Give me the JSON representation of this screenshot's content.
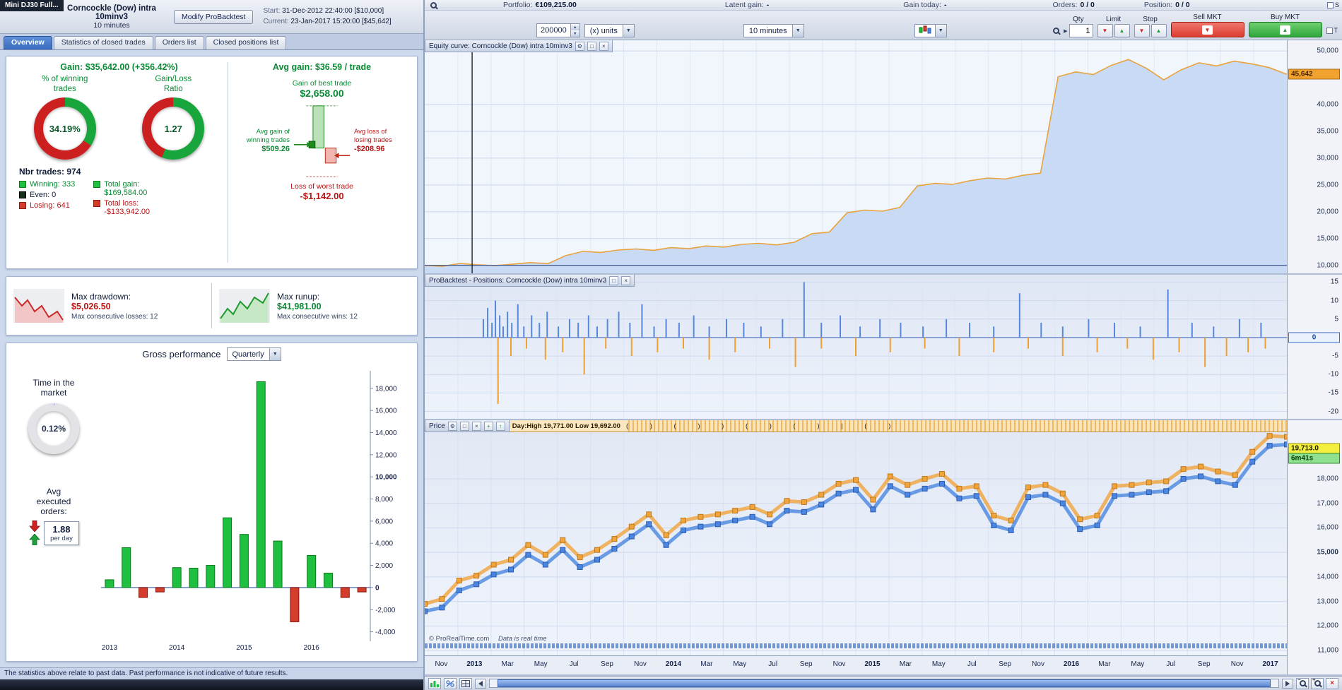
{
  "colors": {
    "green": "#1fbf3f",
    "red": "#d43c2c",
    "accent_blue": "#3a6bc8",
    "equity_line": "#e8a33d",
    "equity_fill": "#c9daf5",
    "sell_red": "#dc3d30",
    "buy_green": "#2fa63c"
  },
  "icons": {
    "settings": "⚙",
    "maximize": "□",
    "close": "×",
    "add": "+",
    "collapse": "↑",
    "dropdown_arrow": "▼",
    "spin_up": "▲",
    "spin_down": "▼",
    "expander": "▶",
    "sell_arrow": "▼",
    "buy_arrow": "▲"
  },
  "left_panel": {
    "instrument_tab": "Mini DJ30 Full...",
    "header": {
      "title": "Corncockle (Dow) intra 10minv3",
      "subtitle": "10 minutes",
      "modify_button": "Modify ProBacktest",
      "start_label": "Start:",
      "start_value": "31-Dec-2012 22:40:00  [$10,000]",
      "current_label": "Current:",
      "current_value": "23-Jan-2017 15:20:00  [$45,642]"
    },
    "tabs": [
      {
        "label": "Overview"
      },
      {
        "label": "Statistics of closed trades"
      },
      {
        "label": "Orders list"
      },
      {
        "label": "Closed positions list"
      }
    ],
    "stats": {
      "gain": "Gain: $35,642.00 (+356.42%)",
      "avg_gain": "Avg gain: $36.59 / trade",
      "pct_winning_label": "% of winning\ntrades",
      "pct_winning_value": "34.19%",
      "pct_winning_num": 34.19,
      "ratio_label": "Gain/Loss\nRatio",
      "ratio_value": "1.27",
      "ratio_green_pct": 55.9,
      "nbr_trades": "Nbr trades: 974",
      "winning": "Winning: 333",
      "even": "Even: 0",
      "losing": "Losing: 641",
      "total_gain": "Total gain:\n$169,584.00",
      "total_loss": "Total loss:\n-$133,942.00",
      "best_trade_label": "Gain of best trade",
      "best_trade_value": "$2,658.00",
      "avg_win_label": "Avg gain of\nwinning trades",
      "avg_win_value": "$509.26",
      "avg_loss_label": "Avg loss of\nlosing trades",
      "avg_loss_value": "-$208.96",
      "worst_trade_label": "Loss of worst trade",
      "worst_trade_value": "-$1,142.00"
    },
    "drawdown": {
      "label": "Max drawdown:",
      "value": "$5,026.50",
      "sub": "Max consecutive losses: 12"
    },
    "runup": {
      "label": "Max runup:",
      "value": "$41,981.00",
      "sub": "Max consecutive wins: 12"
    },
    "performance": {
      "title": "Gross performance",
      "period": "Quarterly",
      "time_in_market_label": "Time in the\nmarket",
      "time_in_market_value": "0.12%",
      "time_in_market_num": 0.12,
      "avg_orders_label": "Avg\nexecuted\norders:",
      "avg_orders_value": "1.88",
      "avg_orders_unit": "per day"
    },
    "disclaimer": "The statistics above relate to past data. Past performance is not indicative of future results."
  },
  "right_panel": {
    "info_bar": {
      "portfolio_label": "Portfolio:",
      "portfolio_value": "€109,215.00",
      "latent_label": "Latent gain:",
      "latent_value": "-",
      "today_label": "Gain today:",
      "today_value": "-",
      "orders_label": "Orders:",
      "orders_value": "0 / 0",
      "position_label": "Position:",
      "position_value": "0 / 0"
    },
    "toolbar": {
      "quantity_value": "200000",
      "units_select": "(x) units",
      "timeframe_select": "10 minutes",
      "qty_header": "Qty",
      "qty_value": "1",
      "limit_header": "Limit",
      "stop_header": "Stop",
      "sell_mkt": "Sell MKT",
      "buy_mkt": "Buy MKT",
      "checkbox_s": "S",
      "checkbox_t": "T"
    },
    "equity_title": "Equity curve: Corncockle (Dow) intra 10minv3",
    "positions_title": "ProBacktest - Positions: Corncockle (Dow) intra 10minv3",
    "price_title": "Price",
    "day_info": "Day:High 19,771.00 Low 19,692.00",
    "session_marks": "( )   ( ) )   (   )   ( )   |   ( )",
    "copyright": "© ProRealTime.com",
    "realtime_note": "Data is real time"
  },
  "chart_data": [
    {
      "id": "gross_performance",
      "type": "bar",
      "title": "Gross performance ($, quarterly)",
      "categories": [
        "2013 Q1",
        "2013 Q2",
        "2013 Q3",
        "2013 Q4",
        "2014 Q1",
        "2014 Q2",
        "2014 Q3",
        "2014 Q4",
        "2015 Q1",
        "2015 Q2",
        "2015 Q3",
        "2015 Q4",
        "2016 Q1",
        "2016 Q2",
        "2016 Q3",
        "2016 Q4"
      ],
      "values": [
        700,
        3600,
        -900,
        -400,
        1800,
        1750,
        2000,
        6300,
        4800,
        18600,
        4200,
        -3100,
        2900,
        1300,
        -900,
        -400
      ],
      "x_tick_labels": [
        "2013",
        "2014",
        "2015",
        "2016"
      ],
      "x_tick_indices": [
        0,
        4,
        8,
        12
      ],
      "y_ticks": [
        18000,
        16000,
        14000,
        12000,
        10000,
        8000,
        6000,
        4000,
        2000,
        0,
        -2000,
        -4000
      ],
      "bold_ticks": [
        10000,
        0
      ],
      "ylim": [
        -4600,
        19200
      ],
      "positive_color": "#1fbf3f",
      "negative_color": "#d43c2c"
    },
    {
      "id": "equity_curve",
      "type": "area",
      "title": "Equity curve: Corncockle (Dow) intra 10minv3",
      "x_range": [
        "Nov-2012",
        "Jan-2017"
      ],
      "values": [
        10000,
        9800,
        10350,
        10100,
        9950,
        10200,
        10500,
        10300,
        11800,
        12600,
        12400,
        12850,
        13050,
        12800,
        13300,
        13100,
        13600,
        13400,
        13900,
        14100,
        13800,
        14300,
        15900,
        16200,
        19800,
        20300,
        20100,
        20800,
        24800,
        25300,
        25100,
        25800,
        26300,
        26100,
        26800,
        27200,
        45200,
        46100,
        45600,
        47300,
        48400,
        46800,
        44600,
        46500,
        47800,
        47200,
        48100,
        47600,
        46900,
        45642
      ],
      "ylim": [
        8500,
        52000
      ],
      "y_ticks": [
        50000,
        40000,
        35000,
        30000,
        25000,
        20000,
        15000,
        10000
      ],
      "current_value": 45642,
      "current_label": "45,642",
      "baseline_value": 10000,
      "start_marker_x": 0.055,
      "line_color": "#e8a33d",
      "fill_color": "#c9daf5"
    },
    {
      "id": "positions",
      "type": "bar",
      "title": "ProBacktest - Positions: Corncockle (Dow) intra 10minv3",
      "y_ticks": [
        15,
        10,
        5,
        0,
        -5,
        -10,
        -15,
        -20
      ],
      "ylim": [
        -22,
        17
      ],
      "zero_label": "0",
      "up_color": "#5588dd",
      "down_color": "#f0a030",
      "up_bars": [
        [
          0.068,
          5
        ],
        [
          0.073,
          8
        ],
        [
          0.078,
          4
        ],
        [
          0.082,
          10
        ],
        [
          0.087,
          6
        ],
        [
          0.091,
          3
        ],
        [
          0.096,
          7
        ],
        [
          0.101,
          4
        ],
        [
          0.108,
          9
        ],
        [
          0.115,
          3
        ],
        [
          0.124,
          6
        ],
        [
          0.133,
          4
        ],
        [
          0.142,
          7
        ],
        [
          0.155,
          3
        ],
        [
          0.168,
          5
        ],
        [
          0.178,
          4
        ],
        [
          0.19,
          6
        ],
        [
          0.2,
          3
        ],
        [
          0.212,
          5
        ],
        [
          0.225,
          7
        ],
        [
          0.238,
          4
        ],
        [
          0.252,
          9
        ],
        [
          0.266,
          3
        ],
        [
          0.28,
          5
        ],
        [
          0.295,
          4
        ],
        [
          0.312,
          6
        ],
        [
          0.33,
          3
        ],
        [
          0.35,
          5
        ],
        [
          0.37,
          4
        ],
        [
          0.39,
          3
        ],
        [
          0.415,
          5
        ],
        [
          0.44,
          15
        ],
        [
          0.46,
          4
        ],
        [
          0.482,
          6
        ],
        [
          0.505,
          3
        ],
        [
          0.528,
          5
        ],
        [
          0.552,
          4
        ],
        [
          0.578,
          3
        ],
        [
          0.605,
          5
        ],
        [
          0.632,
          4
        ],
        [
          0.66,
          3
        ],
        [
          0.69,
          12
        ],
        [
          0.715,
          4
        ],
        [
          0.74,
          3
        ],
        [
          0.77,
          5
        ],
        [
          0.8,
          4
        ],
        [
          0.83,
          3
        ],
        [
          0.862,
          13
        ],
        [
          0.89,
          4
        ],
        [
          0.915,
          3
        ],
        [
          0.945,
          5
        ],
        [
          0.97,
          4
        ]
      ],
      "down_bars": [
        [
          0.085,
          -18
        ],
        [
          0.1,
          -5
        ],
        [
          0.118,
          -3
        ],
        [
          0.14,
          -6
        ],
        [
          0.16,
          -4
        ],
        [
          0.185,
          -10
        ],
        [
          0.21,
          -3
        ],
        [
          0.24,
          -5
        ],
        [
          0.27,
          -4
        ],
        [
          0.3,
          -3
        ],
        [
          0.33,
          -6
        ],
        [
          0.36,
          -4
        ],
        [
          0.4,
          -3
        ],
        [
          0.43,
          -8
        ],
        [
          0.46,
          -3
        ],
        [
          0.5,
          -5
        ],
        [
          0.54,
          -4
        ],
        [
          0.58,
          -3
        ],
        [
          0.62,
          -5
        ],
        [
          0.66,
          -4
        ],
        [
          0.7,
          -3
        ],
        [
          0.74,
          -5
        ],
        [
          0.78,
          -4
        ],
        [
          0.815,
          -3
        ],
        [
          0.845,
          -6
        ],
        [
          0.875,
          -4
        ],
        [
          0.905,
          -8
        ],
        [
          0.93,
          -5
        ],
        [
          0.955,
          -4
        ],
        [
          0.975,
          -3
        ]
      ]
    },
    {
      "id": "price",
      "type": "line",
      "title": "Price (Mini DJ30)",
      "x_labels": [
        "Nov",
        "2013",
        "Mar",
        "May",
        "Jul",
        "Sep",
        "Nov",
        "2014",
        "Mar",
        "May",
        "Jul",
        "Sep",
        "Nov",
        "2015",
        "Mar",
        "May",
        "Jul",
        "Sep",
        "Nov",
        "2016",
        "Mar",
        "May",
        "Jul",
        "Sep",
        "Nov",
        "2017"
      ],
      "bold_labels": [
        "2013",
        "2014",
        "2015",
        "2016",
        "2017"
      ],
      "y_ticks": [
        18000,
        17000,
        16000,
        15000,
        14000,
        13000,
        12000,
        11000
      ],
      "bold_ticks": [
        15000
      ],
      "ylim": [
        10800,
        19900
      ],
      "series": [
        {
          "name": "price-upper",
          "color": "#f0a43c",
          "stroke": "#c07818",
          "values": [
            12900,
            13100,
            13850,
            14050,
            14500,
            14700,
            15300,
            14900,
            15500,
            14800,
            15100,
            15550,
            16050,
            16550,
            15700,
            16300,
            16450,
            16550,
            16700,
            16850,
            16550,
            17100,
            17050,
            17350,
            17800,
            17950,
            17150,
            18100,
            17750,
            18000,
            18200,
            17600,
            17700,
            16500,
            16300,
            17650,
            17750,
            17400,
            16350,
            16500,
            17700,
            17750,
            17850,
            17900,
            18400,
            18500,
            18300,
            18150,
            19100,
            19750,
            19713
          ]
        },
        {
          "name": "price-lower",
          "color": "#4a86e0",
          "stroke": "#2b5cb0",
          "values": [
            12600,
            12750,
            13450,
            13700,
            14100,
            14300,
            14900,
            14500,
            15100,
            14400,
            14700,
            15150,
            15650,
            16150,
            15300,
            15900,
            16050,
            16150,
            16300,
            16450,
            16150,
            16700,
            16650,
            16950,
            17400,
            17550,
            16750,
            17700,
            17350,
            17600,
            17800,
            17200,
            17300,
            16100,
            15900,
            17250,
            17350,
            17000,
            15950,
            16100,
            17300,
            17350,
            17450,
            17500,
            18000,
            18100,
            17900,
            17750,
            18700,
            19350,
            19400
          ]
        }
      ],
      "current_value": 19713.0,
      "current_label": "19,713.0",
      "countdown": "6m41s",
      "day_high": "19,771.00",
      "day_low": "19,692.00"
    }
  ]
}
